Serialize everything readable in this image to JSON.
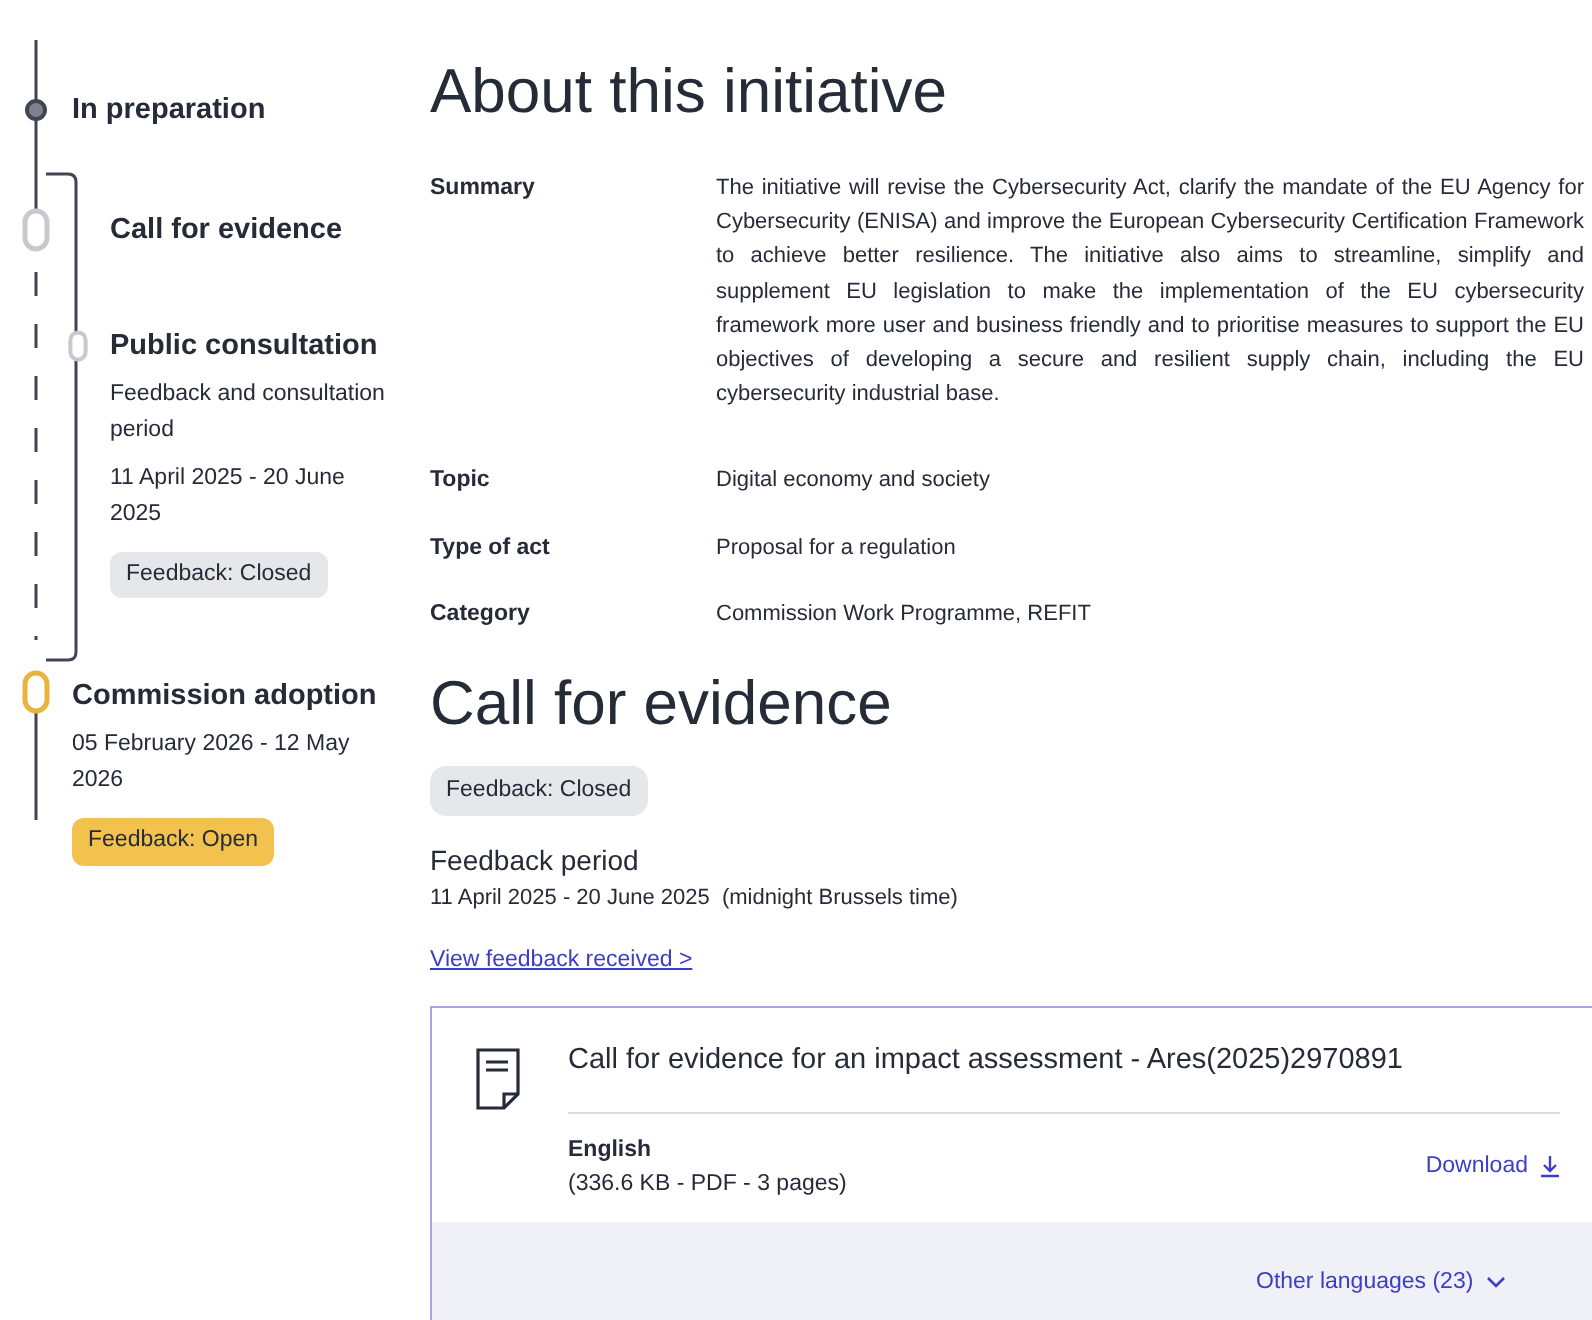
{
  "timeline": [
    {
      "kind": "done",
      "title": "In preparation"
    },
    {
      "kind": "past",
      "title": "Call for evidence",
      "children": [
        {
          "kind": "sub",
          "title": "Public consultation",
          "description": "Feedback and consultation period",
          "dates": "11 April 2025 - 20 June 2025",
          "badge": {
            "label": "Feedback: Closed",
            "open": false
          }
        }
      ]
    },
    {
      "kind": "current",
      "title": "Commission adoption",
      "dates": "05 February 2026 - 12 May 2026",
      "badge": {
        "label": "Feedback: Open",
        "open": true
      }
    }
  ],
  "initiative": {
    "title": "About this initiative",
    "fields": [
      {
        "label": "Summary",
        "value": "The initiative will revise the Cybersecurity Act, clarify the mandate of the EU Agency for Cybersecurity (ENISA) and improve the European Cybersecurity Certification Framework to achieve better resilience. The initiative also aims to streamline, simplify and supplement EU legislation to make the implementation of the EU cybersecurity framework more user and business friendly and to prioritise measures to support the EU objectives of developing a secure and resilient supply chain, including the EU cybersecurity industrial base."
      },
      {
        "label": "Topic",
        "value": "Digital economy and society"
      },
      {
        "label": "Type of act",
        "value": "Proposal for a regulation"
      },
      {
        "label": "Category",
        "value": "Commission Work Programme, REFIT"
      }
    ]
  },
  "call_for_evidence": {
    "title": "Call for evidence",
    "badge": {
      "label": "Feedback: Closed",
      "open": false
    },
    "period_title": "Feedback period",
    "period": "11 April 2025 - 20 June 2025  (midnight Brussels time)",
    "link": "View feedback received >",
    "document": {
      "title": "Call for evidence for an impact assessment - Ares(2025)2970891",
      "language": "English",
      "details": "(336.6 KB - PDF - 3 pages)",
      "download": "Download",
      "other_languages": "Other languages (23)"
    }
  }
}
